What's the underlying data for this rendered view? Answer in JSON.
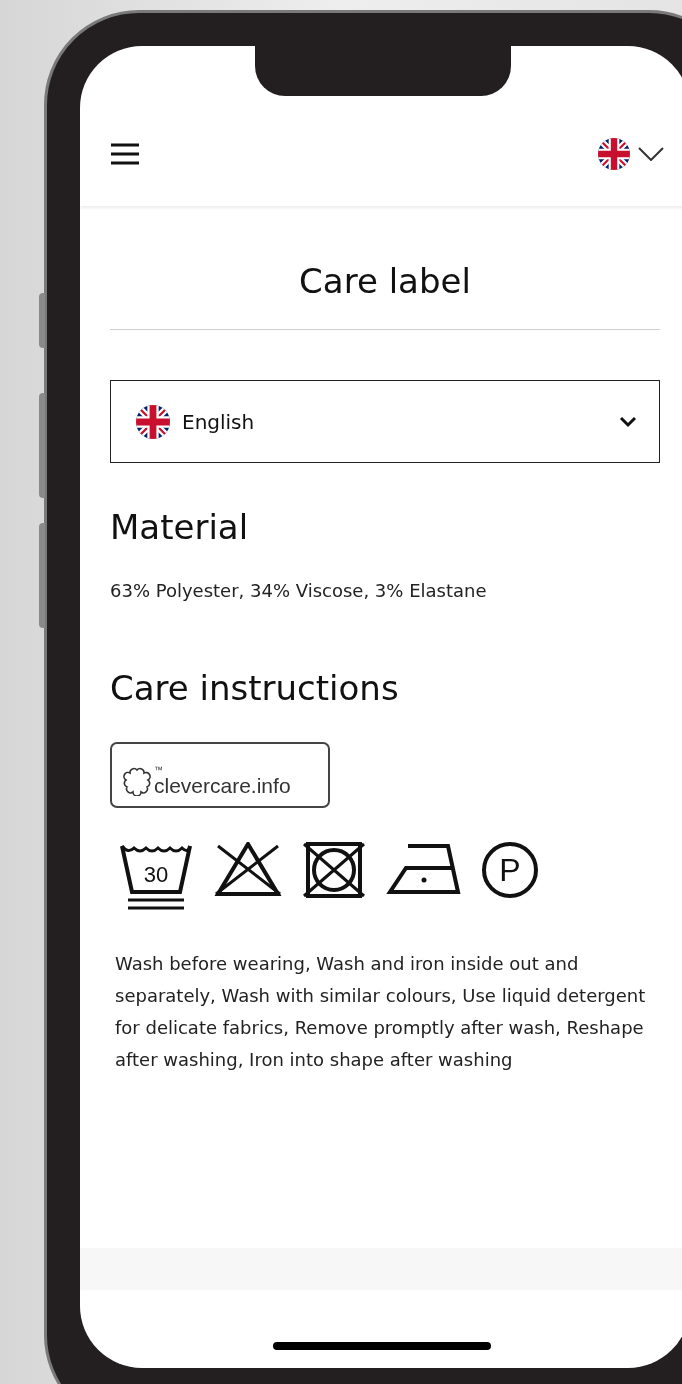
{
  "header": {
    "language_button": {
      "expanded": false
    }
  },
  "title": "Care label",
  "language_select": {
    "value": "English"
  },
  "material": {
    "heading": "Material",
    "text": "63% Polyester, 34% Viscose, 3% Elastane"
  },
  "care": {
    "heading": "Care instructions",
    "logo": {
      "text": "clevercare.info",
      "mark": "™"
    },
    "symbols": [
      {
        "kind": "wash",
        "text": "30"
      },
      {
        "kind": "no_bleach"
      },
      {
        "kind": "no_tumble_dry"
      },
      {
        "kind": "iron"
      },
      {
        "kind": "dry_clean",
        "text": "P"
      }
    ],
    "text": "Wash before wearing, Wash and iron inside out and separately, Wash with similar colours, Use liquid detergent for delicate fabrics, Remove promptly after wash, Reshape after washing, Iron into shape after washing"
  }
}
